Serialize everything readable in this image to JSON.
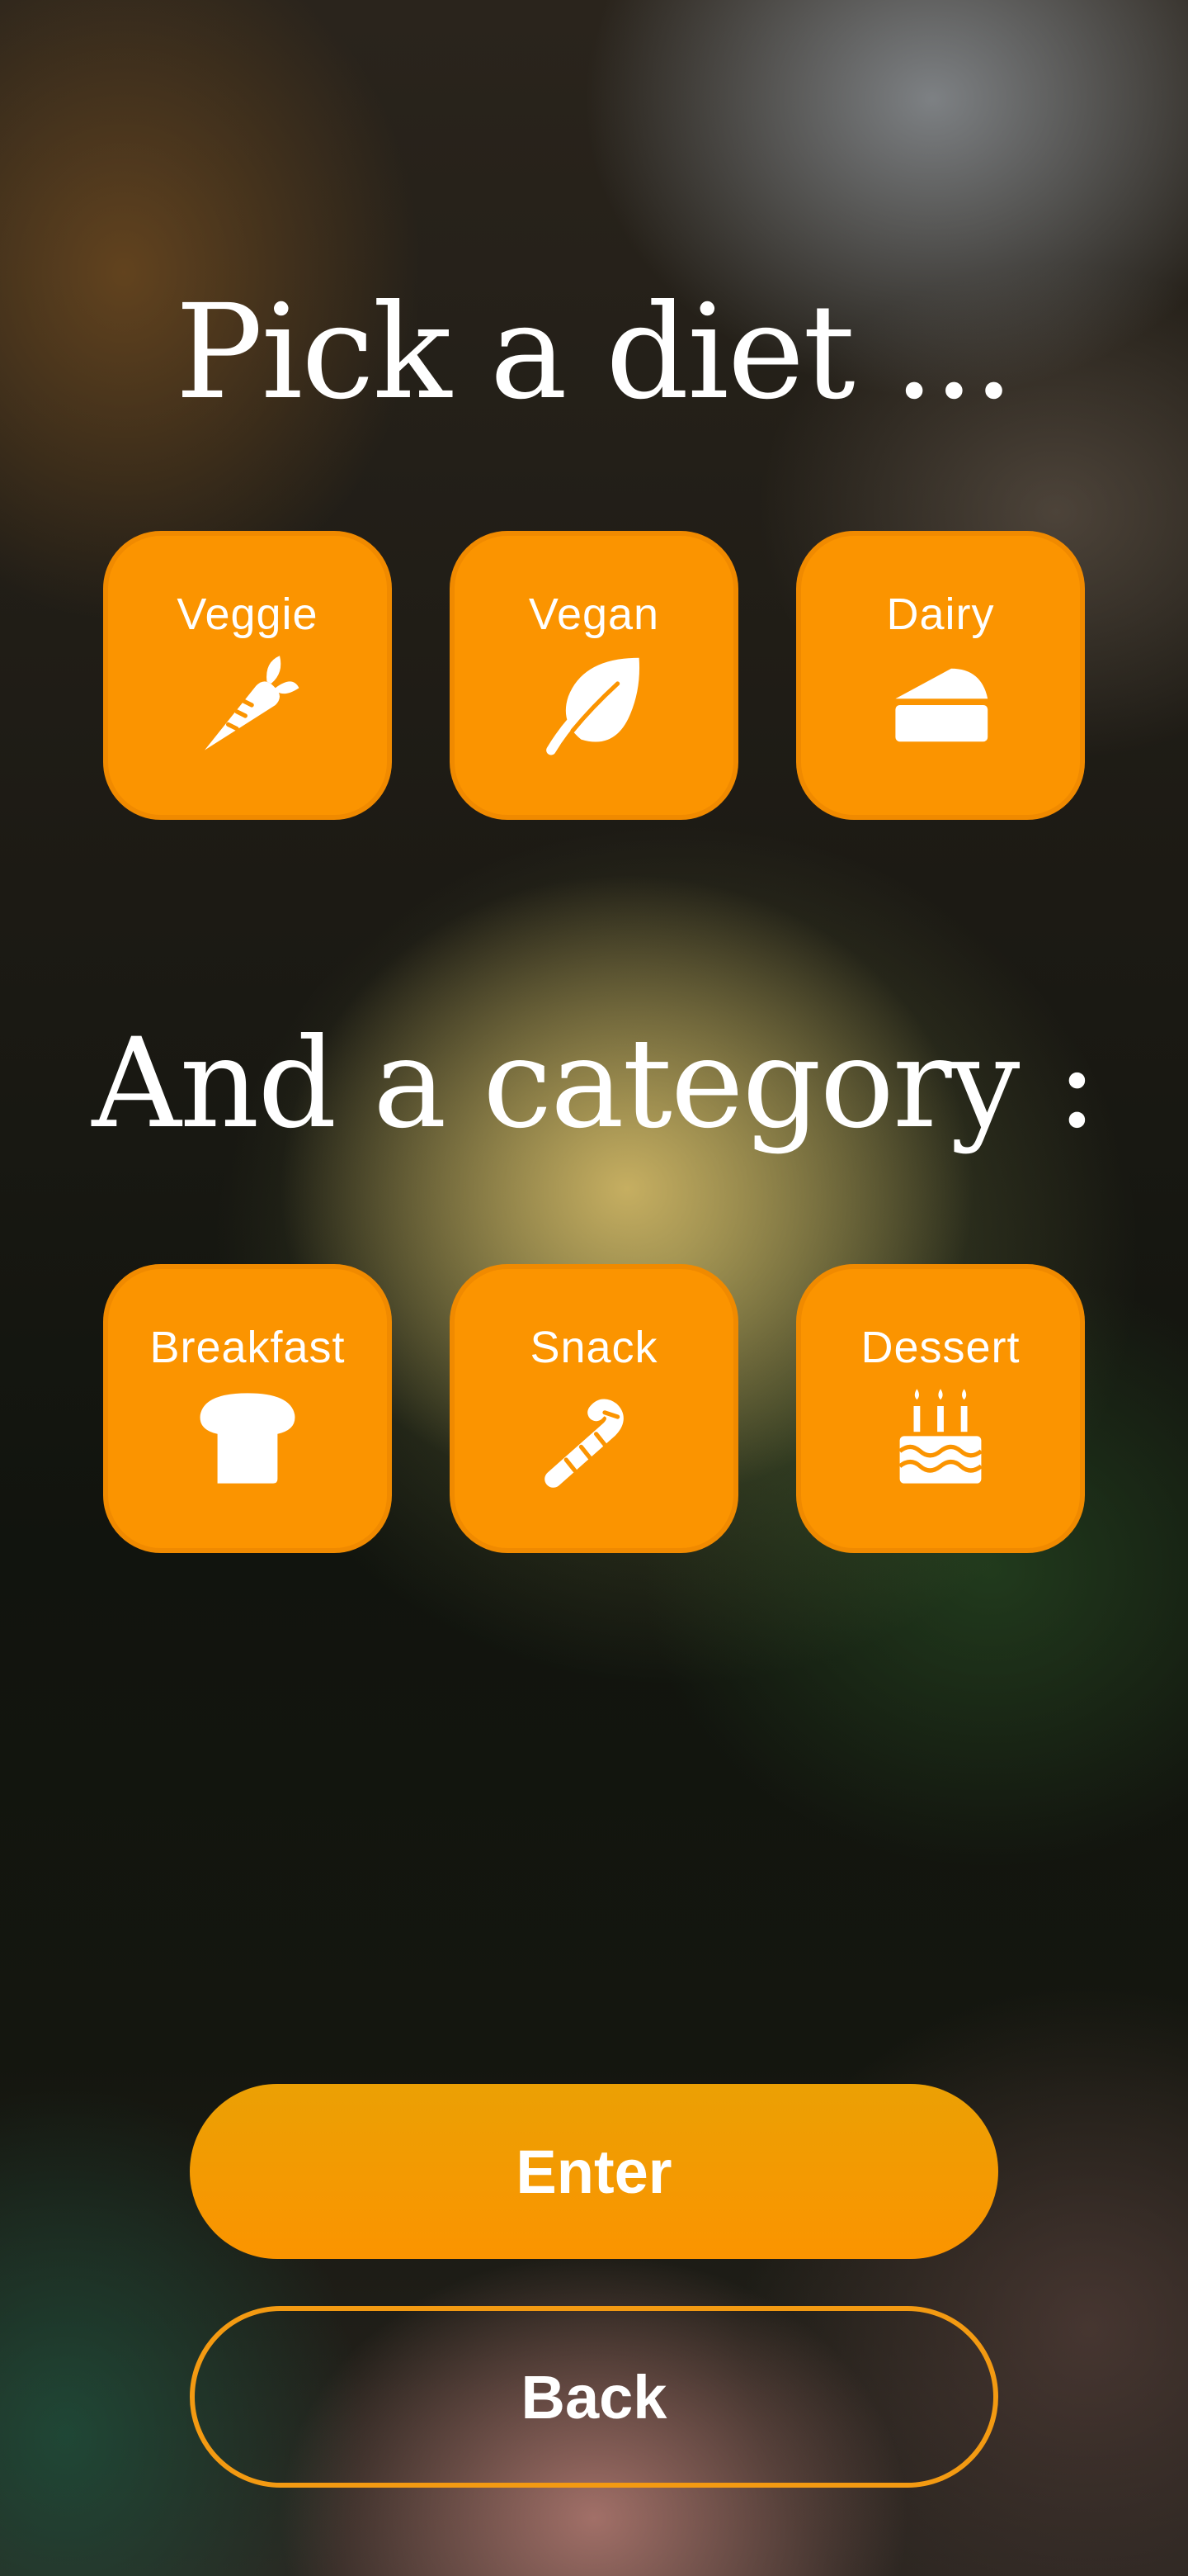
{
  "diet_section": {
    "title": "Pick a diet ...",
    "options": [
      {
        "label": "Veggie",
        "icon": "carrot-icon"
      },
      {
        "label": "Vegan",
        "icon": "leaf-icon"
      },
      {
        "label": "Dairy",
        "icon": "cheese-icon"
      }
    ]
  },
  "category_section": {
    "title": "And a category :",
    "options": [
      {
        "label": "Breakfast",
        "icon": "bread-icon"
      },
      {
        "label": "Snack",
        "icon": "candy-cane-icon"
      },
      {
        "label": "Dessert",
        "icon": "birthday-cake-icon"
      }
    ]
  },
  "actions": {
    "enter_label": "Enter",
    "back_label": "Back"
  },
  "colors": {
    "accent": "#fb9400",
    "text": "#ffffff"
  }
}
